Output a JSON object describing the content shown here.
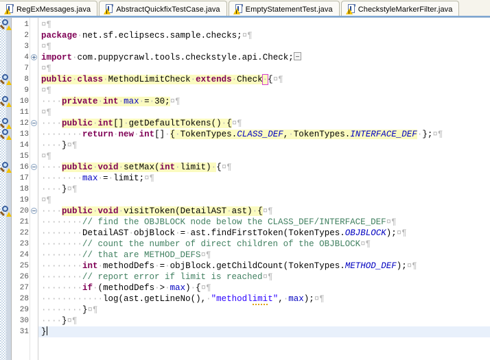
{
  "window": {
    "application": "Eclipse Java Editor",
    "active_file": "RegExMessages.java"
  },
  "tabs": [
    {
      "label": "RegExMessages.java",
      "icon": "java-file-warning-icon",
      "active": false
    },
    {
      "label": "AbstractQuickfixTestCase.java",
      "icon": "java-file-warning-icon",
      "active": false
    },
    {
      "label": "EmptyStatementTest.java",
      "icon": "java-file-warning-icon",
      "active": false
    },
    {
      "label": "CheckstyleMarkerFilter.java",
      "icon": "java-file-warning-icon",
      "active": false
    }
  ],
  "editor": {
    "whitespace_symbol": "·",
    "eol_symbol": "¤¶",
    "caret_line": 31,
    "colors": {
      "keyword": "#7f0055",
      "string": "#2a00ff",
      "comment": "#3f7f5f",
      "field": "#0000c0",
      "static_field": "#0000c0",
      "occurrence_highlight": "#fbfbc0",
      "caret_line_bg": "#e8f0fb",
      "bracket_match_outline": "#d33fd3",
      "warning_squiggle": "#e0a000",
      "tab_bar_bg": "#f6f4ec",
      "tab_active_underline": "#7ea6d1"
    },
    "lines": [
      {
        "num": 1,
        "marker": true,
        "fold": null,
        "text": ""
      },
      {
        "num": 2,
        "marker": false,
        "fold": null,
        "text": "package net.sf.eclipsecs.sample.checks;"
      },
      {
        "num": 3,
        "marker": false,
        "fold": null,
        "text": ""
      },
      {
        "num": 4,
        "marker": false,
        "fold": "plus",
        "text": "import com.puppycrawl.tools.checkstyle.api.Check;"
      },
      {
        "num": 7,
        "marker": false,
        "fold": null,
        "text": ""
      },
      {
        "num": 8,
        "marker": true,
        "fold": null,
        "text": "public class MethodLimitCheck extends Check {"
      },
      {
        "num": 9,
        "marker": false,
        "fold": null,
        "text": ""
      },
      {
        "num": 10,
        "marker": true,
        "fold": null,
        "text": "    private int max = 30;"
      },
      {
        "num": 11,
        "marker": false,
        "fold": null,
        "text": ""
      },
      {
        "num": 12,
        "marker": true,
        "fold": "minus",
        "text": "    public int[] getDefaultTokens() {"
      },
      {
        "num": 13,
        "marker": true,
        "fold": null,
        "text": "        return new int[] { TokenTypes.CLASS_DEF, TokenTypes.INTERFACE_DEF };"
      },
      {
        "num": 14,
        "marker": false,
        "fold": null,
        "text": "    }"
      },
      {
        "num": 15,
        "marker": false,
        "fold": null,
        "text": ""
      },
      {
        "num": 16,
        "marker": true,
        "fold": "minus",
        "text": "    public void setMax(int limit) {"
      },
      {
        "num": 17,
        "marker": false,
        "fold": null,
        "text": "        max = limit;"
      },
      {
        "num": 18,
        "marker": false,
        "fold": null,
        "text": "    }"
      },
      {
        "num": 19,
        "marker": false,
        "fold": null,
        "text": ""
      },
      {
        "num": 20,
        "marker": true,
        "fold": "minus",
        "text": "    public void visitToken(DetailAST ast) {"
      },
      {
        "num": 21,
        "marker": false,
        "fold": null,
        "text": "        // find the OBJBLOCK node below the CLASS_DEF/INTERFACE_DEF"
      },
      {
        "num": 22,
        "marker": false,
        "fold": null,
        "text": "        DetailAST objBlock = ast.findFirstToken(TokenTypes.OBJBLOCK);"
      },
      {
        "num": 23,
        "marker": false,
        "fold": null,
        "text": "        // count the number of direct children of the OBJBLOCK"
      },
      {
        "num": 24,
        "marker": false,
        "fold": null,
        "text": "        // that are METHOD_DEFS"
      },
      {
        "num": 25,
        "marker": false,
        "fold": null,
        "text": "        int methodDefs = objBlock.getChildCount(TokenTypes.METHOD_DEF);"
      },
      {
        "num": 26,
        "marker": false,
        "fold": null,
        "text": "        // report error if limit is reached"
      },
      {
        "num": 27,
        "marker": false,
        "fold": null,
        "text": "        if (methodDefs > max) {"
      },
      {
        "num": 28,
        "marker": false,
        "fold": null,
        "text": "            log(ast.getLineNo(), \"methodlimit\", max);"
      },
      {
        "num": 29,
        "marker": false,
        "fold": null,
        "text": "        }"
      },
      {
        "num": 30,
        "marker": false,
        "fold": null,
        "text": "    }"
      },
      {
        "num": 31,
        "marker": false,
        "fold": null,
        "text": "}"
      }
    ]
  }
}
